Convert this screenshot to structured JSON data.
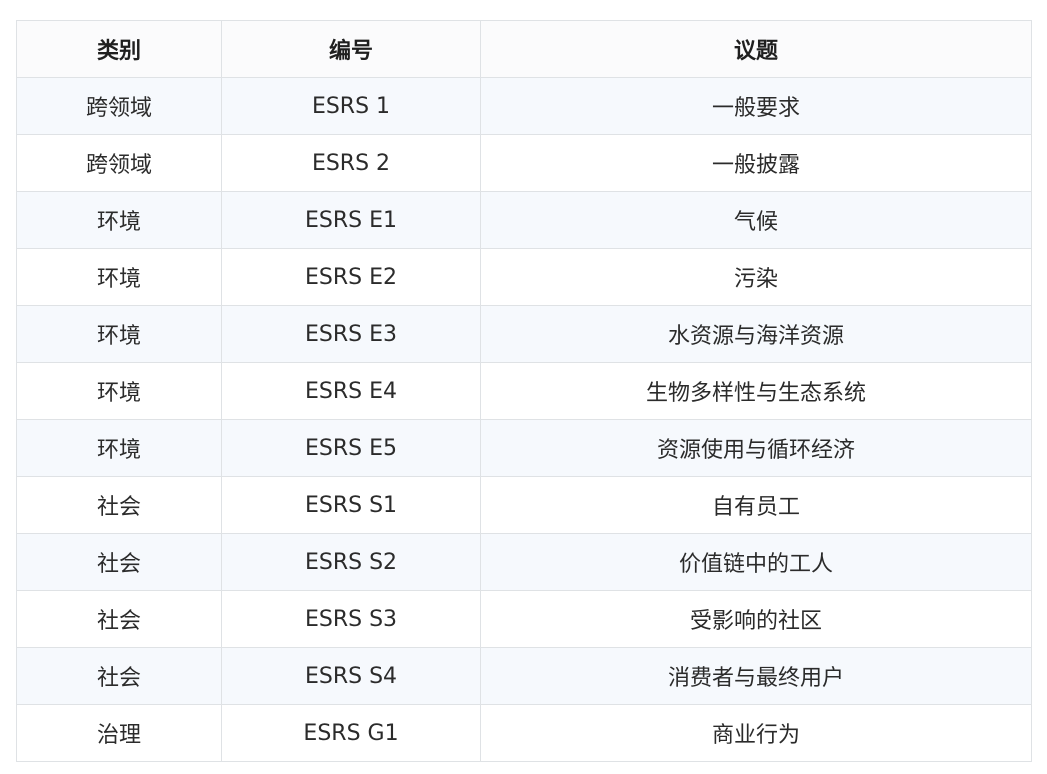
{
  "table": {
    "headers": [
      "类别",
      "编号",
      "议题"
    ],
    "rows": [
      [
        "跨领域",
        "ESRS 1",
        "一般要求"
      ],
      [
        "跨领域",
        "ESRS 2",
        "一般披露"
      ],
      [
        "环境",
        "ESRS E1",
        "气候"
      ],
      [
        "环境",
        "ESRS E2",
        "污染"
      ],
      [
        "环境",
        "ESRS E3",
        "水资源与海洋资源"
      ],
      [
        "环境",
        "ESRS E4",
        "生物多样性与生态系统"
      ],
      [
        "环境",
        "ESRS E5",
        "资源使用与循环经济"
      ],
      [
        "社会",
        "ESRS S1",
        "自有员工"
      ],
      [
        "社会",
        "ESRS S2",
        "价值链中的工人"
      ],
      [
        "社会",
        "ESRS S3",
        "受影响的社区"
      ],
      [
        "社会",
        "ESRS S4",
        "消费者与最终用户"
      ],
      [
        "治理",
        "ESRS G1",
        "商业行为"
      ]
    ]
  }
}
